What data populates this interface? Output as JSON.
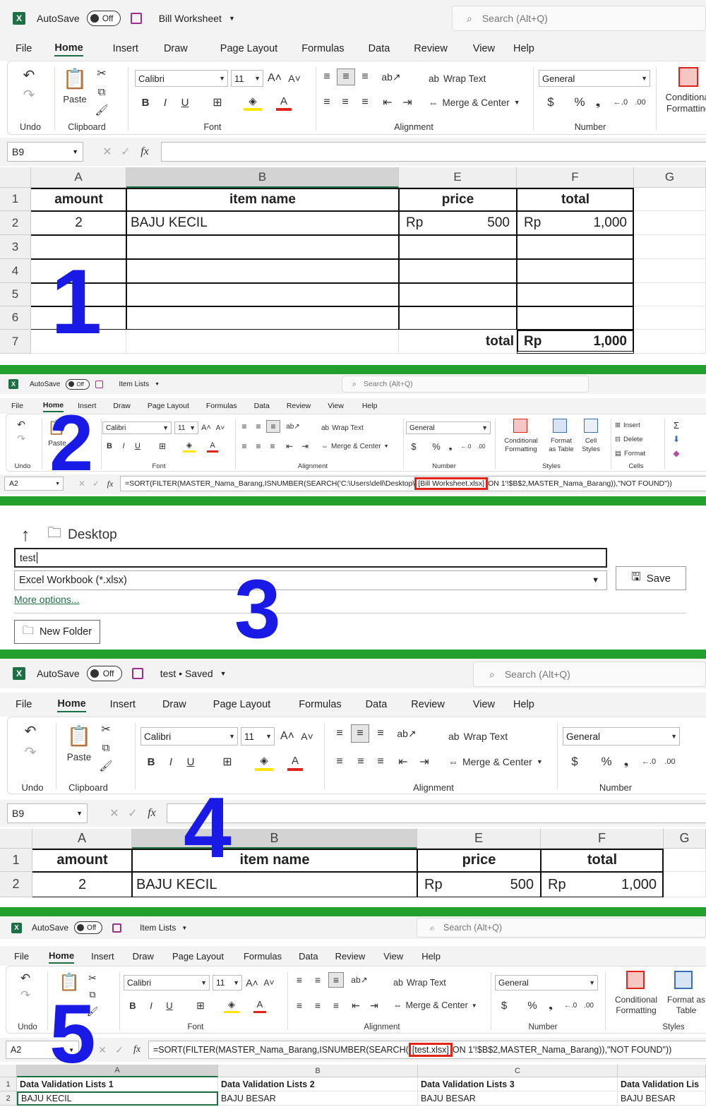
{
  "panels": {
    "p1": {
      "number": "1",
      "titlebar": {
        "autosave": "AutoSave",
        "toggle": "Off",
        "filename": "Bill Worksheet",
        "search": "Search (Alt+Q)"
      },
      "menu": [
        "File",
        "Home",
        "Insert",
        "Draw",
        "Page Layout",
        "Formulas",
        "Data",
        "Review",
        "View",
        "Help"
      ],
      "ribbon": {
        "groups": [
          "Undo",
          "Clipboard",
          "Font",
          "Alignment",
          "Number"
        ],
        "paste": "Paste",
        "font_name": "Calibri",
        "font_size": "11",
        "wrap_text": "Wrap Text",
        "merge_center": "Merge & Center",
        "number_format": "General",
        "conditional": "Conditional Formatting"
      },
      "formula_bar": {
        "name_box": "B9",
        "formula": ""
      },
      "columns": [
        "A",
        "B",
        "E",
        "F",
        "G"
      ],
      "rows": [
        "1",
        "2",
        "3",
        "4",
        "5",
        "6",
        "7"
      ],
      "headers": {
        "amount": "amount",
        "item": "item name",
        "price": "price",
        "total": "total"
      },
      "row2": {
        "amount": "2",
        "item": "BAJU KECIL",
        "price_cur": "Rp",
        "price": "500",
        "total_cur": "Rp",
        "total": "1,000"
      },
      "row7": {
        "label": "total",
        "cur": "Rp",
        "value": "1,000"
      }
    },
    "p2": {
      "number": "2",
      "titlebar": {
        "autosave": "AutoSave",
        "toggle": "Off",
        "filename": "Item Lists",
        "search": "Search (Alt+Q)"
      },
      "menu": [
        "File",
        "Home",
        "Insert",
        "Draw",
        "Page Layout",
        "Formulas",
        "Data",
        "Review",
        "View",
        "Help"
      ],
      "ribbon": {
        "groups": [
          "Undo",
          "Clipboard",
          "Font",
          "Alignment",
          "Number",
          "Styles",
          "Cells"
        ],
        "paste": "Paste",
        "font_name": "Calibri",
        "font_size": "11",
        "wrap_text": "Wrap Text",
        "merge_center": "Merge & Center",
        "number_format": "General",
        "conditional": "Conditional Formatting",
        "format_table": "Format as Table",
        "cell_styles": "Cell Styles",
        "insert": "Insert",
        "delete": "Delete",
        "format": "Format"
      },
      "formula_bar": {
        "name_box": "A2",
        "formula_pre": "=SORT(FILTER(MASTER_Nama_Barang,ISNUMBER(SEARCH('C:\\Users\\dell\\Desktop\\",
        "formula_highlight": "[Bill Worksheet.xlsx]",
        "formula_post": "ON 1'!$B$2,MASTER_Nama_Barang)),\"NOT FOUND\"))"
      }
    },
    "p3": {
      "number": "3",
      "location": "Desktop",
      "filename_value": "test",
      "file_type": "Excel Workbook (*.xlsx)",
      "more_options": "More options...",
      "save": "Save",
      "new_folder": "New Folder"
    },
    "p4": {
      "number": "4",
      "titlebar": {
        "autosave": "AutoSave",
        "toggle": "Off",
        "filename": "test • Saved",
        "search": "Search (Alt+Q)"
      },
      "menu": [
        "File",
        "Home",
        "Insert",
        "Draw",
        "Page Layout",
        "Formulas",
        "Data",
        "Review",
        "View",
        "Help"
      ],
      "ribbon": {
        "groups": [
          "Undo",
          "Clipboard",
          "Font",
          "Alignment",
          "Number"
        ],
        "paste": "Paste",
        "font_name": "Calibri",
        "font_size": "11",
        "wrap_text": "Wrap Text",
        "merge_center": "Merge & Center",
        "number_format": "General"
      },
      "formula_bar": {
        "name_box": "B9",
        "formula": ""
      },
      "columns": [
        "A",
        "B",
        "E",
        "F",
        "G"
      ],
      "rows": [
        "1",
        "2"
      ],
      "headers": {
        "amount": "amount",
        "item": "item name",
        "price": "price",
        "total": "total"
      },
      "row2": {
        "amount": "2",
        "item": "BAJU KECIL",
        "price_cur": "Rp",
        "price": "500",
        "total_cur": "Rp",
        "total": "1,000"
      }
    },
    "p5": {
      "number": "5",
      "titlebar": {
        "autosave": "AutoSave",
        "toggle": "Off",
        "filename": "Item Lists",
        "search": "Search (Alt+Q)"
      },
      "menu": [
        "File",
        "Home",
        "Insert",
        "Draw",
        "Page Layout",
        "Formulas",
        "Data",
        "Review",
        "View",
        "Help"
      ],
      "ribbon": {
        "groups": [
          "Undo",
          "Clipboard",
          "Font",
          "Alignment",
          "Number",
          "Styles"
        ],
        "paste": "Paste",
        "font_name": "Calibri",
        "font_size": "11",
        "wrap_text": "Wrap Text",
        "merge_center": "Merge & Center",
        "number_format": "General",
        "conditional": "Conditional Formatting",
        "format_table": "Format as Table"
      },
      "formula_bar": {
        "name_box": "A2",
        "formula_pre": "=SORT(FILTER(MASTER_Nama_Barang,ISNUMBER(SEARCH(",
        "formula_highlight": "[test.xlsx]",
        "formula_post": "ON 1'!$B$2,MASTER_Nama_Barang)),\"NOT FOUND\"))"
      },
      "columns": [
        "A",
        "B",
        "C"
      ],
      "rows": [
        "1",
        "2"
      ],
      "row1": [
        "Data Validation Lists 1",
        "Data Validation Lists 2",
        "Data Validation Lists 3",
        "Data Validation Lis"
      ],
      "row2": [
        "BAJU KECIL",
        "BAJU BESAR",
        "BAJU BESAR",
        "BAJU BESAR"
      ]
    }
  },
  "colors": {
    "excel_green": "#1d7044",
    "divider": "#22a02d",
    "number": "#1a1ae6",
    "highlight": "#e2231a"
  }
}
